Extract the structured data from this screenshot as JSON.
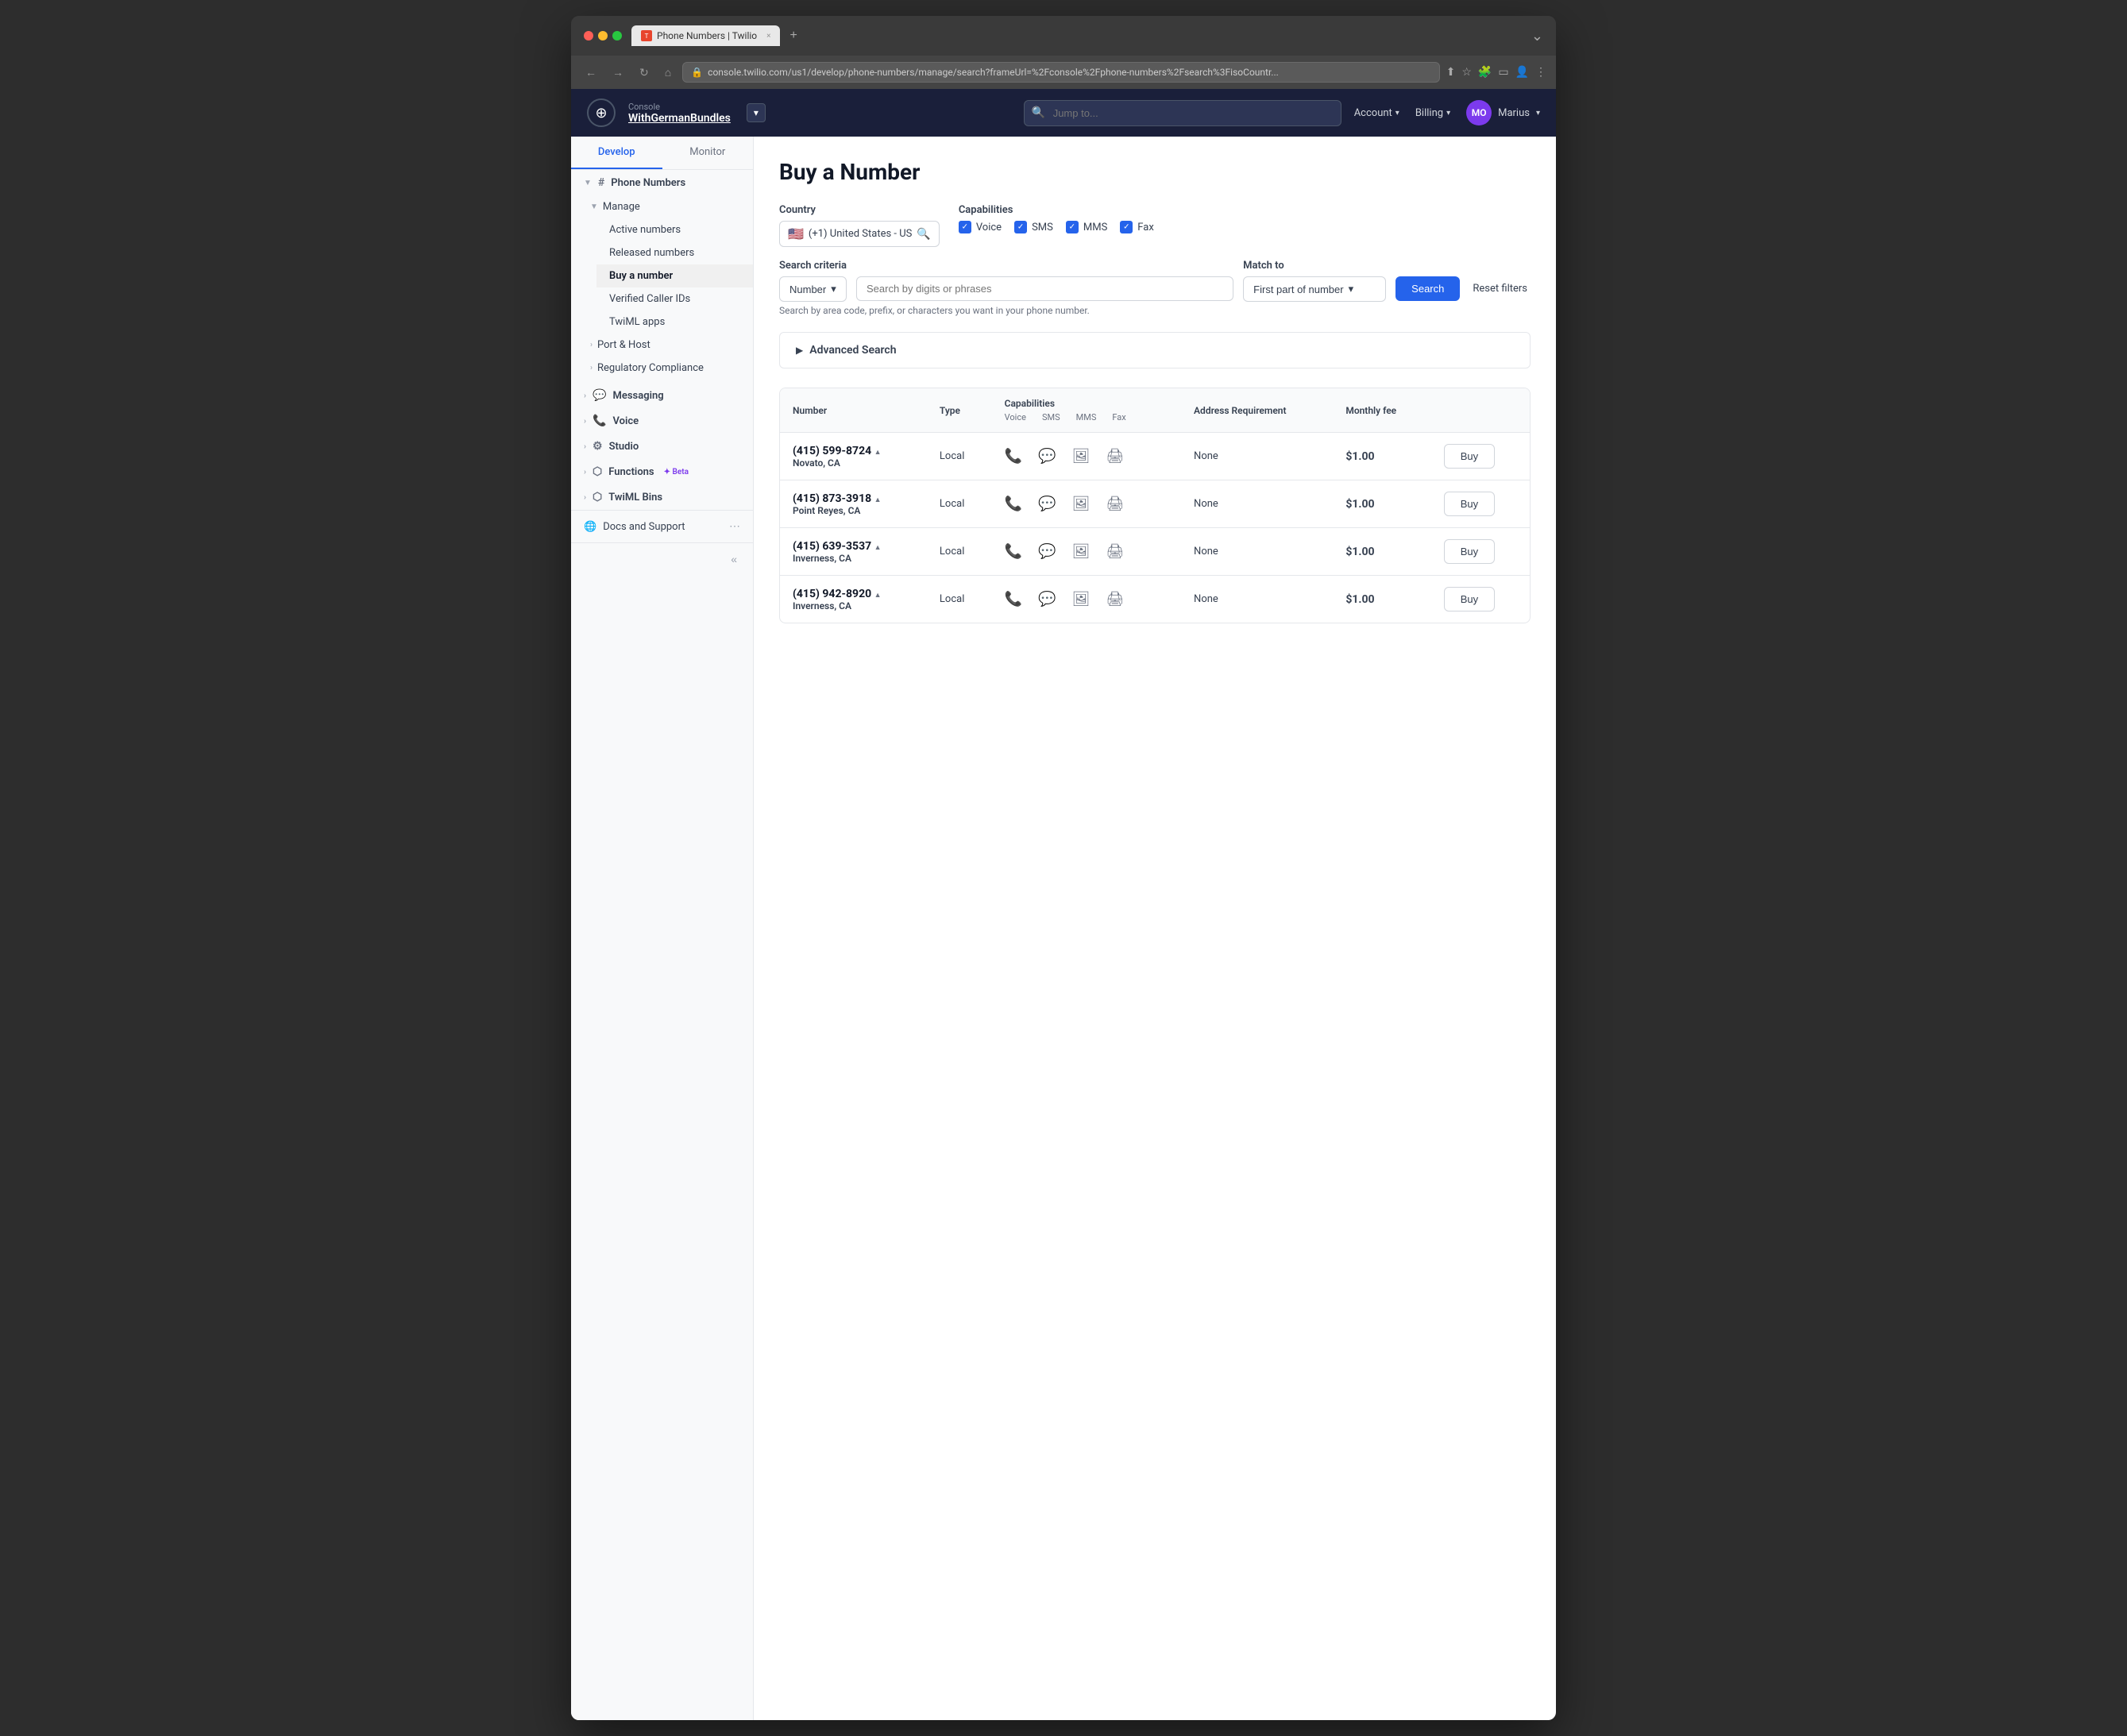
{
  "browser": {
    "tab_title": "Phone Numbers | Twilio",
    "tab_close": "×",
    "tab_new": "+",
    "address": "console.twilio.com/us1/develop/phone-numbers/manage/search?frameUrl=%2Fconsole%2Fphone-numbers%2Fsearch%3FisoCountr...",
    "nav_back": "←",
    "nav_forward": "→",
    "nav_refresh": "↻",
    "nav_home": "⌂"
  },
  "topnav": {
    "logo_symbol": "⊕",
    "console_label": "Console",
    "account_name": "WithGermanBundles",
    "dropdown_icon": "▾",
    "search_placeholder": "Jump to...",
    "account_label": "Account",
    "billing_label": "Billing",
    "user_initials": "MO",
    "user_name": "Marius",
    "chevron": "▾"
  },
  "sidebar": {
    "tab_develop": "Develop",
    "tab_monitor": "Monitor",
    "phone_numbers_label": "Phone Numbers",
    "phone_numbers_icon": "#",
    "manage_label": "Manage",
    "active_numbers": "Active numbers",
    "released_numbers": "Released numbers",
    "buy_a_number": "Buy a number",
    "verified_caller_ids": "Verified Caller IDs",
    "twiml_apps": "TwiML apps",
    "port_host_label": "Port & Host",
    "regulatory_compliance": "Regulatory Compliance",
    "messaging_label": "Messaging",
    "voice_label": "Voice",
    "studio_label": "Studio",
    "functions_label": "Functions",
    "beta_label": "Beta",
    "twiml_bins_label": "TwiML Bins",
    "docs_support_label": "Docs and Support",
    "collapse_icon": "«"
  },
  "page": {
    "title": "Buy a Number"
  },
  "search_form": {
    "country_label": "Country",
    "country_flag": "🇺🇸",
    "country_value": "(+1) United States - US",
    "capabilities_label": "Capabilities",
    "voice_label": "Voice",
    "sms_label": "SMS",
    "mms_label": "MMS",
    "fax_label": "Fax",
    "search_criteria_label": "Search criteria",
    "criteria_value": "Number",
    "search_placeholder": "Search by digits or phrases",
    "match_to_label": "Match to",
    "match_value": "First part of number",
    "search_btn": "Search",
    "reset_label": "Reset filters",
    "hint": "Search by area code, prefix, or characters you want in your phone number.",
    "advanced_search_label": "Advanced Search"
  },
  "table": {
    "col_number": "Number",
    "col_type": "Type",
    "col_capabilities": "Capabilities",
    "col_voice": "Voice",
    "col_sms": "SMS",
    "col_mms": "MMS",
    "col_fax": "Fax",
    "col_address": "Address Requirement",
    "col_fee": "Monthly fee",
    "rows": [
      {
        "number": "(415) 599-8724",
        "location": "Novato, CA",
        "type": "Local",
        "address": "None",
        "fee": "$1.00",
        "buy": "Buy"
      },
      {
        "number": "(415) 873-3918",
        "location": "Point Reyes, CA",
        "type": "Local",
        "address": "None",
        "fee": "$1.00",
        "buy": "Buy"
      },
      {
        "number": "(415) 639-3537",
        "location": "Inverness, CA",
        "type": "Local",
        "address": "None",
        "fee": "$1.00",
        "buy": "Buy"
      },
      {
        "number": "(415) 942-8920",
        "location": "Inverness, CA",
        "type": "Local",
        "address": "None",
        "fee": "$1.00",
        "buy": "Buy"
      }
    ]
  }
}
